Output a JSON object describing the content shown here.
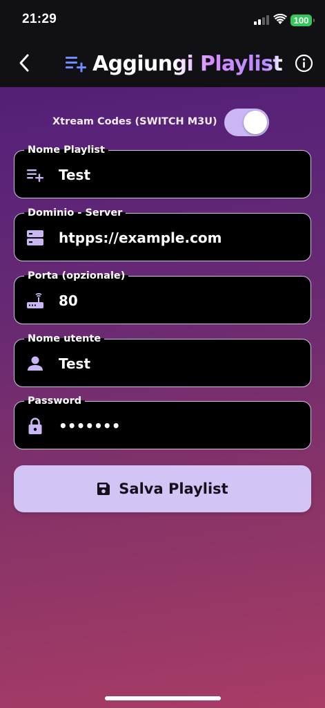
{
  "status_bar": {
    "time": "21:29",
    "battery": "100",
    "battery_color": "#34c759"
  },
  "nav": {
    "back_icon": "chevron-left-icon",
    "title": "Aggiungi Playlist",
    "title_icon": "playlist-add-icon",
    "info_icon": "info-icon"
  },
  "toggle": {
    "label": "Xtream Codes (SWITCH M3U)",
    "on": true
  },
  "fields": [
    {
      "label": "Nome Playlist",
      "value": "Test",
      "icon": "playlist-add-icon"
    },
    {
      "label": "Dominio - Server",
      "value": "htpps://example.com",
      "icon": "server-icon"
    },
    {
      "label": "Porta (opzionale)",
      "value": "80",
      "icon": "router-icon"
    },
    {
      "label": "Nome utente",
      "value": "Test",
      "icon": "person-icon"
    },
    {
      "label": "Password",
      "value": "•••••••",
      "icon": "lock-icon"
    }
  ],
  "save_button": {
    "label": "Salva Playlist",
    "icon": "save-icon"
  },
  "colors": {
    "accent": "#d3c4f6",
    "toggle_track": "#c9b6f2",
    "title_gradient_end": "#b98bff"
  }
}
